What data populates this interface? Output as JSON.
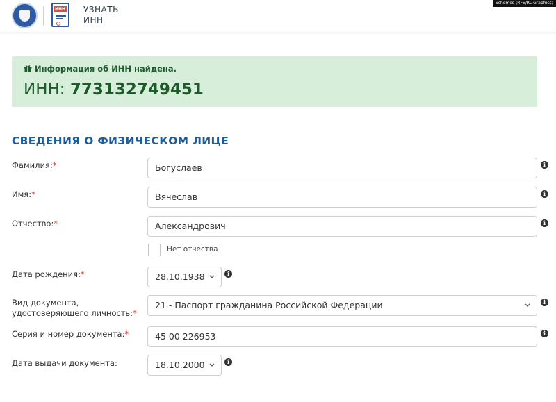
{
  "header": {
    "brand_line1": "УЗНАТЬ",
    "brand_line2": "ИНН",
    "doc_badge": "ИНН",
    "watermark": "Schemes (RFE/RL Graphics)"
  },
  "alert": {
    "icon": "gift-icon",
    "message": "Информация об ИНН найдена.",
    "inn_label": "ИНН: ",
    "inn_value": "773132749451",
    "bg_color": "#d7eedb",
    "text_color": "#1d5b2a"
  },
  "section": {
    "title": "СВЕДЕНИЯ О ФИЗИЧЕСКОМ ЛИЦЕ",
    "title_color": "#1a5d9c"
  },
  "form": {
    "required_mark": "*",
    "lastname": {
      "label": "Фамилия:",
      "value": "Богуслаев"
    },
    "firstname": {
      "label": "Имя:",
      "value": "Вячеслав"
    },
    "patronymic": {
      "label": "Отчество:",
      "value": "Александрович"
    },
    "no_patronymic": {
      "label": "Нет отчества",
      "checked": false
    },
    "birthdate": {
      "label": "Дата рождения:",
      "value": "28.10.1938"
    },
    "doc_type": {
      "label_line1": "Вид документа,",
      "label_line2": "удостоверяющего личность:",
      "value": "21 - Паспорт гражданина Российской Федерации"
    },
    "doc_number": {
      "label": "Серия и номер документа:",
      "value": "45 00 226953"
    },
    "issue_date": {
      "label": "Дата выдачи документа:",
      "value": "18.10.2000"
    },
    "info_glyph": "i"
  }
}
